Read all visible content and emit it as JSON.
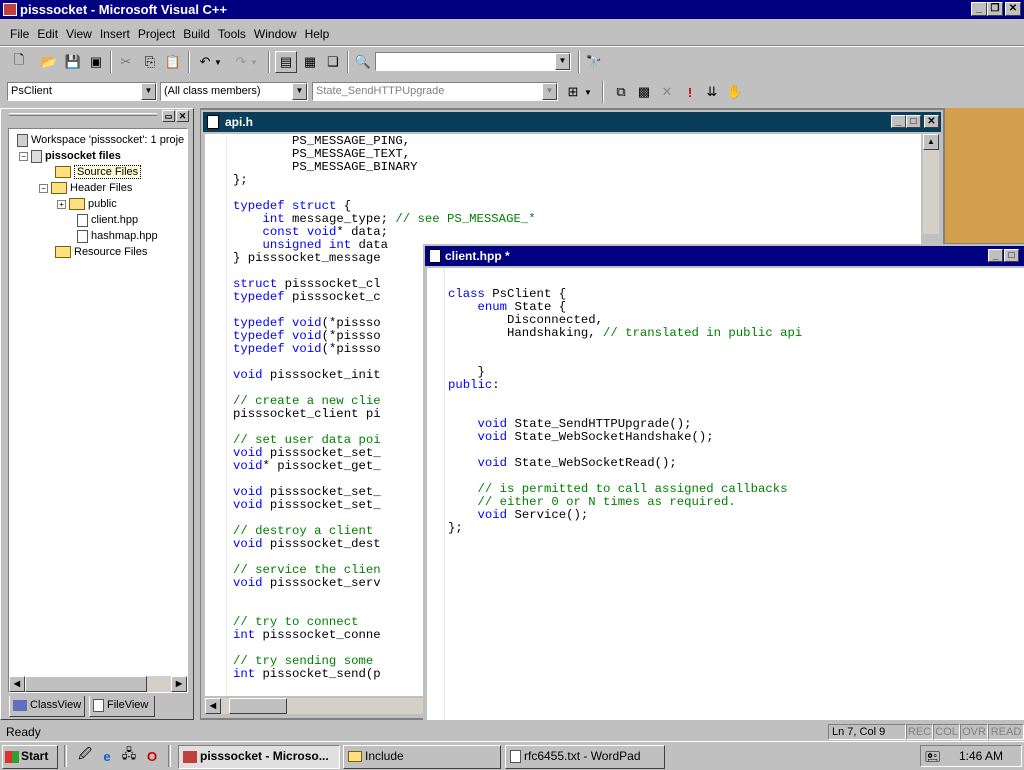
{
  "app": {
    "title": "pisssocket - Microsoft Visual C++",
    "menu": [
      "File",
      "Edit",
      "View",
      "Insert",
      "Project",
      "Build",
      "Tools",
      "Window",
      "Help"
    ]
  },
  "wizardbar": {
    "class": "PsClient",
    "filter": "(All class members)",
    "member": "State_SendHTTPUpgrade"
  },
  "workspace": {
    "root": "Workspace 'pisssocket': 1 proje",
    "project": "pissocket files",
    "items": [
      "Source Files",
      "Header Files",
      "public",
      "client.hpp",
      "hashmap.hpp",
      "Resource Files"
    ],
    "tabs": [
      "ClassView",
      "FileView"
    ]
  },
  "api_window": {
    "title": "api.h",
    "lines": [
      "        PS_MESSAGE_PING,",
      "        PS_MESSAGE_TEXT,",
      "        PS_MESSAGE_BINARY",
      "};",
      "",
      "typedef struct {",
      "    int message_type; // see PS_MESSAGE_*",
      "    const void* data;",
      "    unsigned int data",
      "} pisssocket_message",
      "",
      "struct pisssocket_cl",
      "typedef pisssocket_c",
      "",
      "typedef void(*pissso",
      "typedef void(*pissso",
      "typedef void(*pissso",
      "",
      "void pisssocket_init",
      "",
      "// create a new clie",
      "pisssocket_client pi",
      "",
      "// set user data poi",
      "void pisssocket_set_",
      "void* pissocket_get_",
      "",
      "void pisssocket_set_",
      "void pisssocket_set_",
      "",
      "// destroy a client",
      "void pisssocket_dest",
      "",
      "// service the clien",
      "void pisssocket_serv",
      "",
      "",
      "// try to connect",
      "int pisssocket_conne",
      "",
      "// try sending some",
      "int pissocket_send(p"
    ]
  },
  "client_window": {
    "title": "client.hpp *",
    "lines": [
      "",
      "class PsClient {",
      "    enum State {",
      "        Disconnected,",
      "        Handshaking, // translated in public api",
      "",
      "",
      "    }",
      "public:",
      "",
      "",
      "    void State_SendHTTPUpgrade();",
      "    void State_WebSocketHandshake();",
      "",
      "    void State_WebSocketRead();",
      "",
      "    // is permitted to call assigned callbacks",
      "    // either 0 or N times as required.",
      "    void Service();",
      "};"
    ]
  },
  "status": {
    "text": "Ready",
    "position": "Ln 7, Col 9",
    "indicators": [
      "REC",
      "COL",
      "OVR",
      "READ"
    ]
  },
  "taskbar": {
    "start": "Start",
    "tasks": [
      "pisssocket - Microso...",
      "Include",
      "rfc6455.txt - WordPad"
    ],
    "clock": "1:46 AM"
  }
}
